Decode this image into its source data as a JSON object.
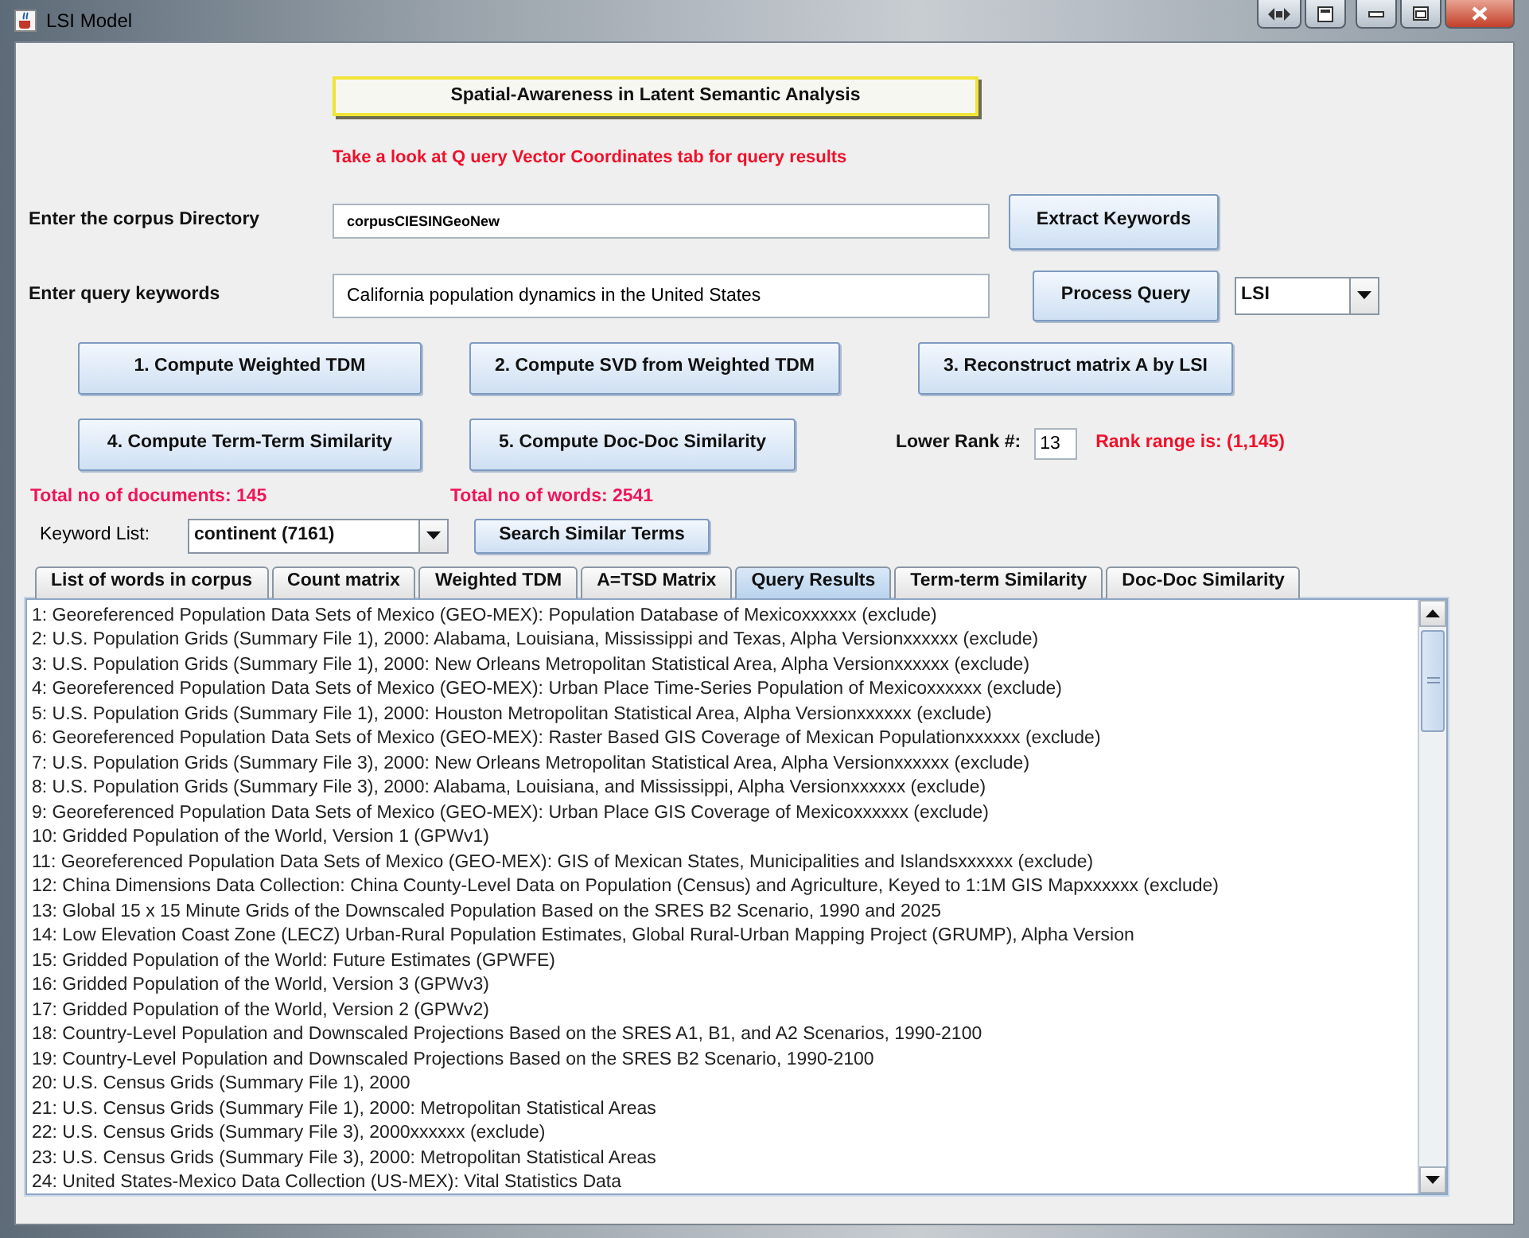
{
  "window": {
    "title": "LSI Model"
  },
  "header": {
    "title": "Spatial-Awareness in Latent Semantic Analysis"
  },
  "notice": "Take a look at Q uery Vector Coordinates tab for query results",
  "corpus": {
    "label": "Enter the corpus Directory",
    "value": "corpusCIESINGeoNew",
    "button": "Extract Keywords"
  },
  "query": {
    "label": "Enter query keywords",
    "value": "California population dynamics in the United States",
    "button": "Process Query",
    "method": "LSI"
  },
  "compute_buttons": [
    [
      "1. Compute Weighted TDM",
      "2. Compute SVD from Weighted TDM",
      "3. Reconstruct matrix A by LSI"
    ],
    [
      "4. Compute Term-Term Similarity",
      "5. Compute Doc-Doc Similarity"
    ]
  ],
  "rank": {
    "label": "Lower Rank #:",
    "value": "13",
    "range": "Rank range is: (1,145)"
  },
  "totals": [
    "Total no of documents: 145",
    "Total no of words: 2541"
  ],
  "keyword": {
    "label": "Keyword List:",
    "value": "continent (7161)",
    "button": "Search Similar Terms"
  },
  "tabs": [
    {
      "label": "List of words in corpus",
      "selected": false
    },
    {
      "label": "Count matrix",
      "selected": false
    },
    {
      "label": "Weighted TDM",
      "selected": false
    },
    {
      "label": "A=TSD Matrix",
      "selected": false
    },
    {
      "label": "Query Results",
      "selected": true
    },
    {
      "label": "Term-term Similarity",
      "selected": false
    },
    {
      "label": "Doc-Doc Similarity",
      "selected": false
    }
  ],
  "results": [
    "1: Georeferenced Population Data Sets of Mexico (GEO-MEX): Population Database of Mexicoxxxxxx (exclude)",
    "2: U.S. Population Grids (Summary File 1), 2000: Alabama, Louisiana, Mississippi and Texas, Alpha Versionxxxxxx (exclude)",
    "3: U.S. Population Grids (Summary File 1), 2000: New Orleans Metropolitan Statistical Area, Alpha Versionxxxxxx (exclude)",
    "4: Georeferenced Population Data Sets of Mexico (GEO-MEX): Urban Place Time-Series Population of Mexicoxxxxxx (exclude)",
    "5: U.S. Population Grids (Summary File 1), 2000: Houston Metropolitan Statistical Area, Alpha Versionxxxxxx (exclude)",
    "6: Georeferenced Population Data Sets of Mexico (GEO-MEX): Raster Based GIS Coverage of Mexican Populationxxxxxx (exclude)",
    "7: U.S. Population Grids (Summary File 3), 2000: New Orleans Metropolitan Statistical Area, Alpha Versionxxxxxx (exclude)",
    "8: U.S. Population Grids (Summary File 3), 2000: Alabama, Louisiana, and Mississippi, Alpha Versionxxxxxx (exclude)",
    "9: Georeferenced Population Data Sets of Mexico (GEO-MEX): Urban Place GIS Coverage of Mexicoxxxxxx (exclude)",
    "10: Gridded Population of the World, Version 1 (GPWv1)",
    "11: Georeferenced Population Data Sets of Mexico (GEO-MEX): GIS of Mexican States, Municipalities and Islandsxxxxxx (exclude)",
    "12: China Dimensions Data Collection: China County-Level Data on Population (Census) and Agriculture, Keyed to 1:1M GIS Mapxxxxxx (exclude)",
    "13: Global 15 x 15 Minute Grids of the Downscaled Population Based on the SRES B2 Scenario, 1990 and 2025",
    "14: Low Elevation Coast Zone (LECZ) Urban-Rural Population Estimates, Global Rural-Urban Mapping Project (GRUMP), Alpha Version",
    "15: Gridded Population of the World: Future Estimates (GPWFE)",
    "16: Gridded Population of the World, Version 3 (GPWv3)",
    "17: Gridded Population of the World, Version 2 (GPWv2)",
    "18: Country-Level Population and Downscaled Projections Based on the SRES A1, B1, and  A2 Scenarios, 1990-2100",
    "19: Country-Level Population and Downscaled Projections Based on the SRES B2 Scenario, 1990-2100",
    "20: U.S. Census Grids (Summary File 1), 2000",
    "21: U.S. Census Grids (Summary File 1), 2000: Metropolitan Statistical Areas",
    "22: U.S. Census Grids (Summary File 3), 2000xxxxxx (exclude)",
    "23: U.S. Census Grids (Summary File 3), 2000: Metropolitan Statistical Areas",
    "24: United States-Mexico Data Collection (US-MEX): Vital Statistics Data"
  ]
}
